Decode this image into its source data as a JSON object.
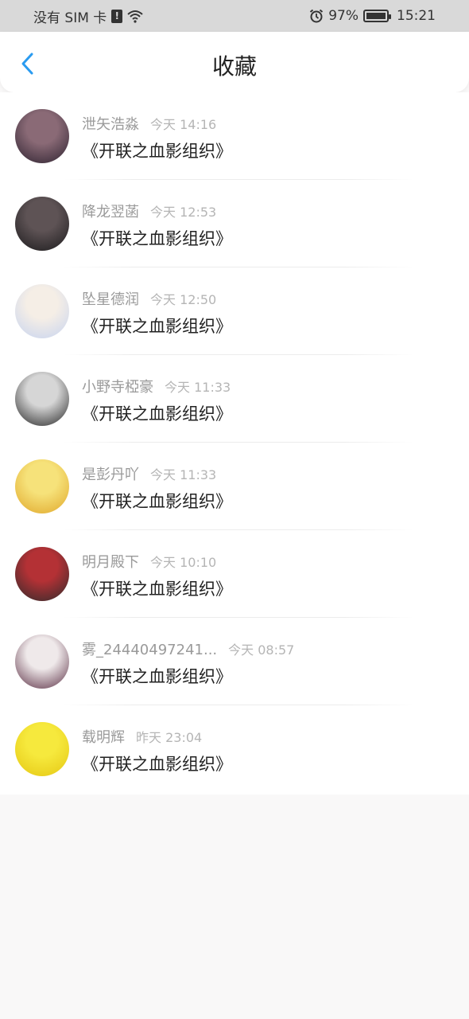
{
  "status_bar": {
    "carrier": "没有 SIM 卡",
    "battery_percent": "97%",
    "time": "15:21",
    "icons": [
      "sim-alert-icon",
      "wifi-icon",
      "alarm-icon",
      "battery-icon"
    ]
  },
  "header": {
    "title": "收藏",
    "back_icon": "chevron-left-icon",
    "accent_color": "#2a9bf0"
  },
  "favorites": [
    {
      "name": "泄矢浩淼",
      "time": "今天 14:16",
      "book": "《开联之血影组织》",
      "avatar_colors": [
        "#8a6a76",
        "#2d2230"
      ]
    },
    {
      "name": "降龙翌菡",
      "time": "今天 12:53",
      "book": "《开联之血影组织》",
      "avatar_colors": [
        "#5e5355",
        "#1b1a1c"
      ]
    },
    {
      "name": "坠星德润",
      "time": "今天 12:50",
      "book": "《开联之血影组织》",
      "avatar_colors": [
        "#f5eee6",
        "#c6d3ef"
      ]
    },
    {
      "name": "小野寺椏豪",
      "time": "今天 11:33",
      "book": "《开联之血影组织》",
      "avatar_colors": [
        "#d6d6d6",
        "#252525"
      ]
    },
    {
      "name": "是彭丹吖",
      "time": "今天 11:33",
      "book": "《开联之血影组织》",
      "avatar_colors": [
        "#f6e27a",
        "#e0a72a"
      ]
    },
    {
      "name": "明月殿下",
      "time": "今天 10:10",
      "book": "《开联之血影组织》",
      "avatar_colors": [
        "#b43135",
        "#2e2b2c"
      ]
    },
    {
      "name": "雾_24440497241...",
      "time": "今天 08:57",
      "book": "《开联之血影组织》",
      "avatar_colors": [
        "#efe9ea",
        "#5b2f44"
      ]
    },
    {
      "name": "载明辉",
      "time": "昨天 23:04",
      "book": "《开联之血影组织》",
      "avatar_colors": [
        "#f6e93d",
        "#e5c713"
      ]
    }
  ]
}
